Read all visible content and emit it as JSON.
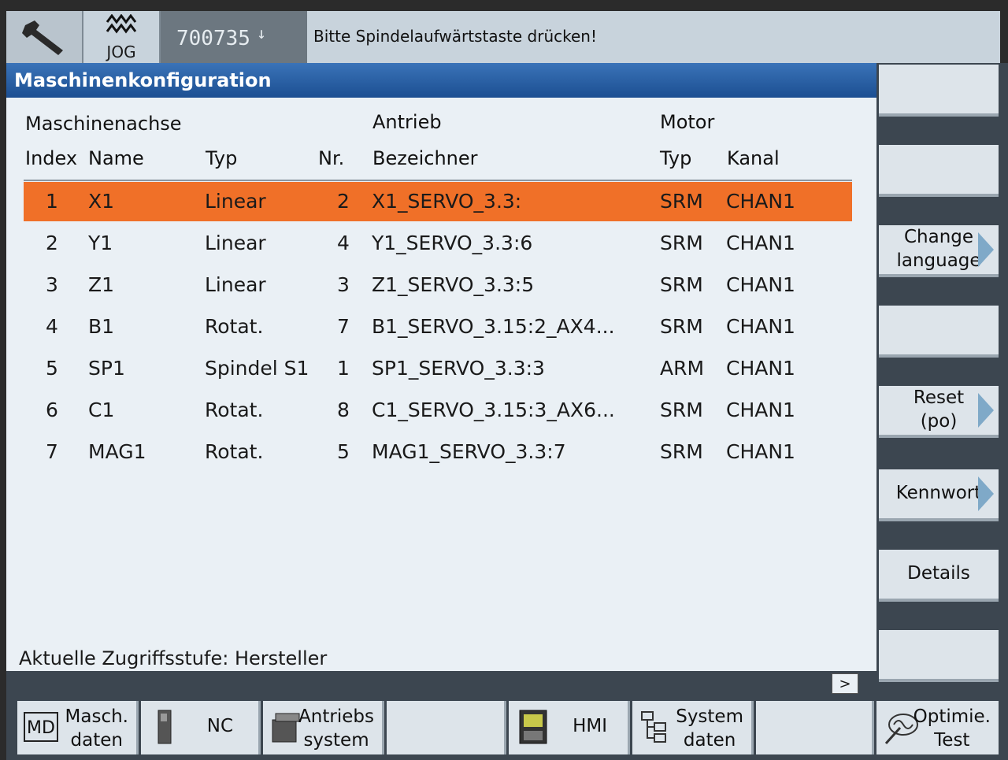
{
  "header": {
    "mode_label": "JOG",
    "program_number": "700735",
    "program_arrow": "↓",
    "message": "Bitte Spindelaufwärtstaste drücken!"
  },
  "window": {
    "title": "Maschinenkonfiguration"
  },
  "table": {
    "group_headers": {
      "axis": "Maschinenachse",
      "drive": "Antrieb",
      "motor": "Motor"
    },
    "columns": {
      "index": "Index",
      "name": "Name",
      "typ": "Typ",
      "nr": "Nr.",
      "bezeichner": "Bezeichner",
      "motor_typ": "Typ",
      "kanal": "Kanal"
    },
    "rows": [
      {
        "index": "1",
        "name": "X1",
        "typ": "Linear",
        "nr": "2",
        "bezeichner": "X1_SERVO_3.3:",
        "motor_typ": "SRM",
        "kanal": "CHAN1"
      },
      {
        "index": "2",
        "name": "Y1",
        "typ": "Linear",
        "nr": "4",
        "bezeichner": "Y1_SERVO_3.3:6",
        "motor_typ": "SRM",
        "kanal": "CHAN1"
      },
      {
        "index": "3",
        "name": "Z1",
        "typ": "Linear",
        "nr": "3",
        "bezeichner": "Z1_SERVO_3.3:5",
        "motor_typ": "SRM",
        "kanal": "CHAN1"
      },
      {
        "index": "4",
        "name": "B1",
        "typ": "Rotat.",
        "nr": "7",
        "bezeichner": "B1_SERVO_3.15:2_AX4...",
        "motor_typ": "SRM",
        "kanal": "CHAN1"
      },
      {
        "index": "5",
        "name": "SP1",
        "typ": "Spindel S1",
        "nr": "1",
        "bezeichner": "SP1_SERVO_3.3:3",
        "motor_typ": "ARM",
        "kanal": "CHAN1"
      },
      {
        "index": "6",
        "name": "C1",
        "typ": "Rotat.",
        "nr": "8",
        "bezeichner": "C1_SERVO_3.15:3_AX6...",
        "motor_typ": "SRM",
        "kanal": "CHAN1"
      },
      {
        "index": "7",
        "name": "MAG1",
        "typ": "Rotat.",
        "nr": "5",
        "bezeichner": "MAG1_SERVO_3.3:7",
        "motor_typ": "SRM",
        "kanal": "CHAN1"
      }
    ]
  },
  "status": {
    "access_level": "Aktuelle Zugriffsstufe: Hersteller",
    "scroll_label": ">"
  },
  "right_softkeys": {
    "change_language": "Change\nlanguage",
    "reset_po": "Reset\n(po)",
    "kennwort": "Kennwort",
    "details": "Details"
  },
  "bottom_softkeys": {
    "masch_daten": "Masch.\ndaten",
    "md_icon_text": "MD",
    "nc": "NC",
    "antriebs_system": "Antriebs\nsystem",
    "hmi": "HMI",
    "system_daten": "System\ndaten",
    "optimie_test": "Optimie.\nTest"
  },
  "colors": {
    "selected_row": "#f07028",
    "title_bar": "#2a62a8",
    "panel_bg": "#eaf0f5",
    "softkey_bg": "#dde4ea"
  }
}
